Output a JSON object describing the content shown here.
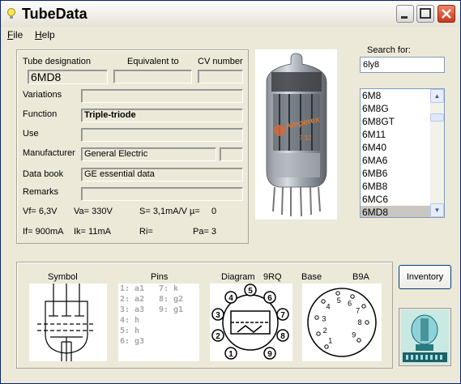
{
  "window": {
    "title": "TubeData"
  },
  "menu": {
    "file": "ile",
    "file_u": "F",
    "help": "elp",
    "help_u": "H"
  },
  "tube": {
    "designation_label": "Tube designation",
    "equivalent_label": "Equivalent to",
    "cv_label": "CV number",
    "designation": "6MD8",
    "equivalent": "",
    "cv": "",
    "variations_label": "Variations",
    "variations": "",
    "function_label": "Function",
    "function": "Triple-triode",
    "use_label": "Use",
    "use": "",
    "manufacturer_label": "Manufacturer",
    "manufacturer": "General Electric",
    "manufacturer_extra": "",
    "databook_label": "Data book",
    "databook": "GE essential data",
    "remarks_label": "Remarks",
    "remarks": "",
    "vf": "Vf= 6,3V",
    "va": "Va= 330V",
    "s": "S= 3,1mA/V",
    "mu": "µ=",
    "mu_val": "0",
    "if": "If= 900mA",
    "ik": "Ik= 11mA",
    "ri": "Ri=",
    "pa": "Pa= 3"
  },
  "search": {
    "label": "Search for:",
    "value": "6ly8",
    "items": [
      "6M8",
      "6M8G",
      "6M8GT",
      "6M11",
      "6M40",
      "6MA6",
      "6MB6",
      "6MB8",
      "6MC6",
      "6MD8"
    ],
    "selected": "6MD8"
  },
  "bottom": {
    "symbol_label": "Symbol",
    "pins_label": "Pins",
    "diagram_label": "Diagram",
    "diagram_code": "9RQ",
    "base_label": "Base",
    "base_code": "B9A",
    "pins_col1": [
      "1: a1",
      "2: a2",
      "3: a3",
      "4: h",
      "5: h",
      "6: g3"
    ],
    "pins_col2": [
      "7: k",
      "8: g2",
      "9: g1"
    ],
    "diagram_numbers": [
      "1",
      "2",
      "3",
      "4",
      "5",
      "6",
      "7",
      "8",
      "9"
    ],
    "base_numbers": [
      "1",
      "2",
      "3",
      "4",
      "5",
      "6",
      "7",
      "8",
      "9"
    ]
  },
  "buttons": {
    "inventory": "Inventory"
  }
}
